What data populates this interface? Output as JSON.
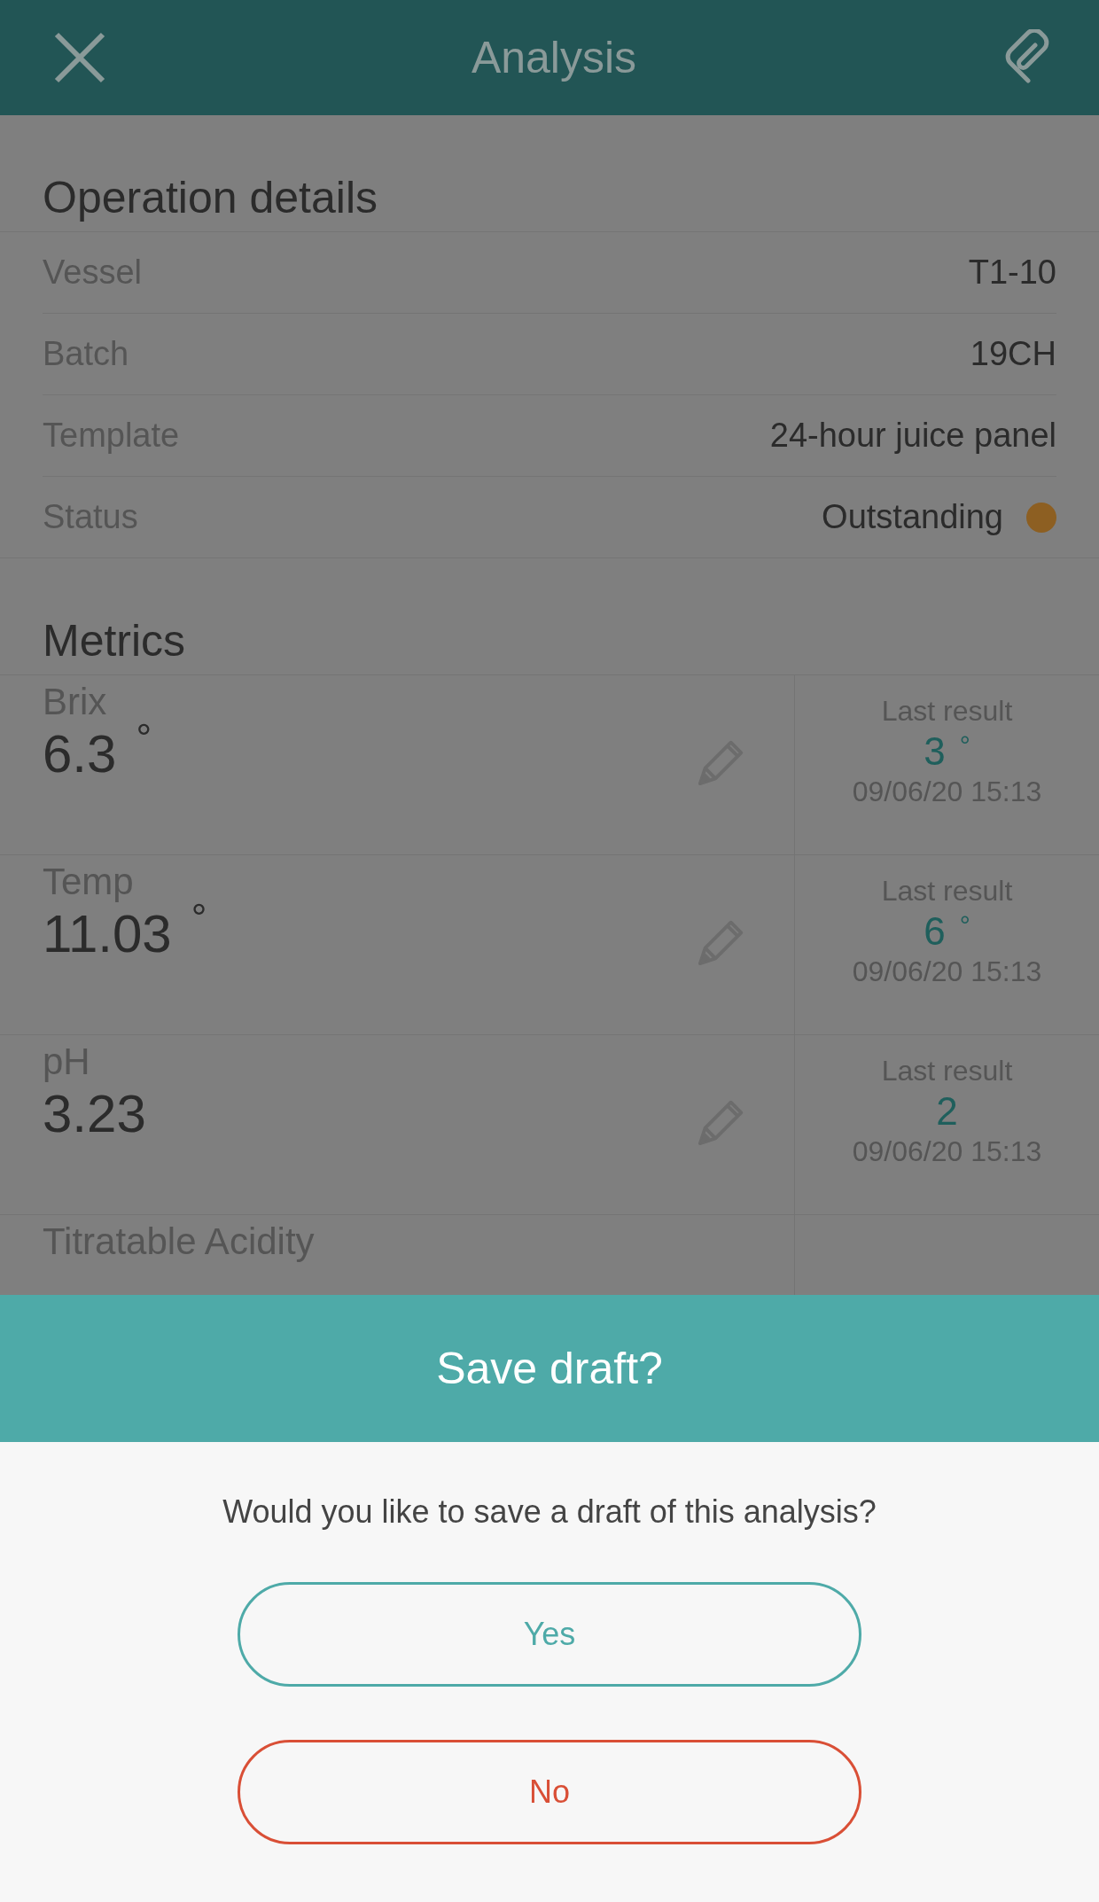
{
  "header": {
    "title": "Analysis"
  },
  "operation_details": {
    "title": "Operation details",
    "rows": [
      {
        "label": "Vessel",
        "value": "T1-10"
      },
      {
        "label": "Batch",
        "value": "19CH"
      },
      {
        "label": "Template",
        "value": "24-hour juice panel"
      },
      {
        "label": "Status",
        "value": "Outstanding",
        "color": "#8d5f22"
      }
    ]
  },
  "metrics": {
    "title": "Metrics",
    "rows": [
      {
        "name": "Brix",
        "value": "6.3",
        "unit": "°",
        "last_label": "Last result",
        "last_value": "3",
        "last_unit": "°",
        "last_date": "09/06/20 15:13"
      },
      {
        "name": "Temp",
        "value": "11.03",
        "unit": "°",
        "last_label": "Last result",
        "last_value": "6",
        "last_unit": "°",
        "last_date": "09/06/20 15:13"
      },
      {
        "name": "pH",
        "value": "3.23",
        "last_label": "Last result",
        "last_value": "2",
        "last_date": "09/06/20 15:13"
      },
      {
        "name": "Titratable Acidity"
      }
    ]
  },
  "dialog": {
    "title": "Save draft?",
    "message": "Would you like to save a draft of this analysis?",
    "buttons": [
      {
        "label": "Yes",
        "kind": "confirm"
      },
      {
        "label": "No",
        "kind": "cancel"
      }
    ]
  }
}
